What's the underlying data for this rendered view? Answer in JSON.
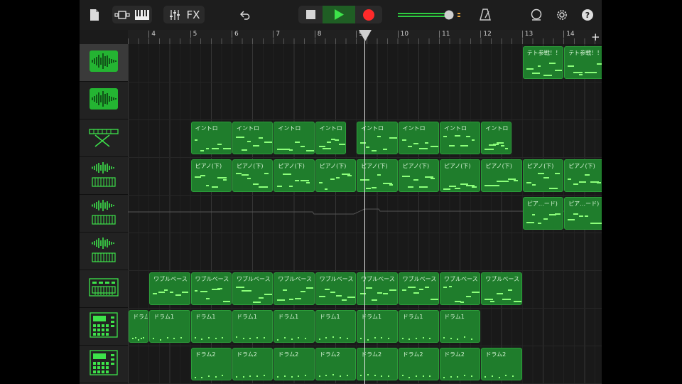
{
  "toolbar": {
    "fx_label": "FX",
    "accent": "#2ecc40",
    "record_color": "#ff2a2a"
  },
  "ruler": {
    "bars": [
      "4",
      "5",
      "6",
      "7",
      "8",
      "9",
      "10",
      "11",
      "12",
      "13",
      "14"
    ]
  },
  "tracks": [
    {
      "icon": "audio-recorder-icon",
      "selected": true
    },
    {
      "icon": "audio-recorder-icon",
      "selected": false
    },
    {
      "icon": "keyboard-stand-icon",
      "selected": false
    },
    {
      "icon": "sampler-keyboard-icon",
      "selected": false
    },
    {
      "icon": "sampler-keyboard-icon",
      "selected": false
    },
    {
      "icon": "sampler-keyboard-icon",
      "selected": false
    },
    {
      "icon": "synth-module-icon",
      "selected": false
    },
    {
      "icon": "drum-machine-icon",
      "selected": false
    },
    {
      "icon": "drum-machine-icon",
      "selected": false
    }
  ],
  "regions": [
    {
      "track": 0,
      "label": "テト参戦！！",
      "bar": 13
    },
    {
      "track": 0,
      "label": "テト参戦！！",
      "bar": 14
    },
    {
      "track": 2,
      "label": "イントロ",
      "bar": 5
    },
    {
      "track": 2,
      "label": "イントロ",
      "bar": 6
    },
    {
      "track": 2,
      "label": "イントロ",
      "bar": 7
    },
    {
      "track": 2,
      "label": "イントロ",
      "bar": 8,
      "len": 0.75
    },
    {
      "track": 2,
      "label": "イントロ",
      "bar": 9
    },
    {
      "track": 2,
      "label": "イントロ",
      "bar": 10
    },
    {
      "track": 2,
      "label": "イントロ",
      "bar": 11
    },
    {
      "track": 2,
      "label": "イントロ",
      "bar": 12,
      "len": 0.75
    },
    {
      "track": 3,
      "label": "ピアノ(下)",
      "bar": 5
    },
    {
      "track": 3,
      "label": "ピアノ(下)",
      "bar": 6
    },
    {
      "track": 3,
      "label": "ピアノ(下)",
      "bar": 7
    },
    {
      "track": 3,
      "label": "ピアノ(下)",
      "bar": 8
    },
    {
      "track": 3,
      "label": "ピアノ(下)",
      "bar": 9
    },
    {
      "track": 3,
      "label": "ピアノ(下)",
      "bar": 10
    },
    {
      "track": 3,
      "label": "ピアノ(下)",
      "bar": 11
    },
    {
      "track": 3,
      "label": "ピアノ(下)",
      "bar": 12
    },
    {
      "track": 3,
      "label": "ピアノ(下)",
      "bar": 13
    },
    {
      "track": 3,
      "label": "ピアノ(下)",
      "bar": 14
    },
    {
      "track": 4,
      "label": "ピア…ード)",
      "bar": 13
    },
    {
      "track": 4,
      "label": "ピア…ード)",
      "bar": 14
    },
    {
      "track": 6,
      "label": "ワブルベース",
      "bar": 4
    },
    {
      "track": 6,
      "label": "ワブルベース",
      "bar": 5
    },
    {
      "track": 6,
      "label": "ワブルベース",
      "bar": 6
    },
    {
      "track": 6,
      "label": "ワブルベース",
      "bar": 7
    },
    {
      "track": 6,
      "label": "ワブルベース",
      "bar": 8
    },
    {
      "track": 6,
      "label": "ワブルベース",
      "bar": 9
    },
    {
      "track": 6,
      "label": "ワブルベース",
      "bar": 10
    },
    {
      "track": 6,
      "label": "ワブルベース",
      "bar": 11
    },
    {
      "track": 6,
      "label": "ワブルベース",
      "bar": 12
    },
    {
      "track": 7,
      "label": "ドラム1",
      "bar": 3.5,
      "len": 0.5
    },
    {
      "track": 7,
      "label": "ドラム1",
      "bar": 4
    },
    {
      "track": 7,
      "label": "ドラム1",
      "bar": 5
    },
    {
      "track": 7,
      "label": "ドラム1",
      "bar": 6
    },
    {
      "track": 7,
      "label": "ドラム1",
      "bar": 7
    },
    {
      "track": 7,
      "label": "ドラム1",
      "bar": 8
    },
    {
      "track": 7,
      "label": "ドラム1",
      "bar": 9
    },
    {
      "track": 7,
      "label": "ドラム1",
      "bar": 10
    },
    {
      "track": 7,
      "label": "ドラム1",
      "bar": 11
    },
    {
      "track": 8,
      "label": "ドラム2",
      "bar": 5
    },
    {
      "track": 8,
      "label": "ドラム2",
      "bar": 6
    },
    {
      "track": 8,
      "label": "ドラム2",
      "bar": 7
    },
    {
      "track": 8,
      "label": "ドラム2",
      "bar": 8
    },
    {
      "track": 8,
      "label": "ドラム2",
      "bar": 9
    },
    {
      "track": 8,
      "label": "ドラム2",
      "bar": 10
    },
    {
      "track": 8,
      "label": "ドラム2",
      "bar": 11
    },
    {
      "track": 8,
      "label": "ドラム2",
      "bar": 12
    }
  ],
  "playhead_bar": 9.1
}
